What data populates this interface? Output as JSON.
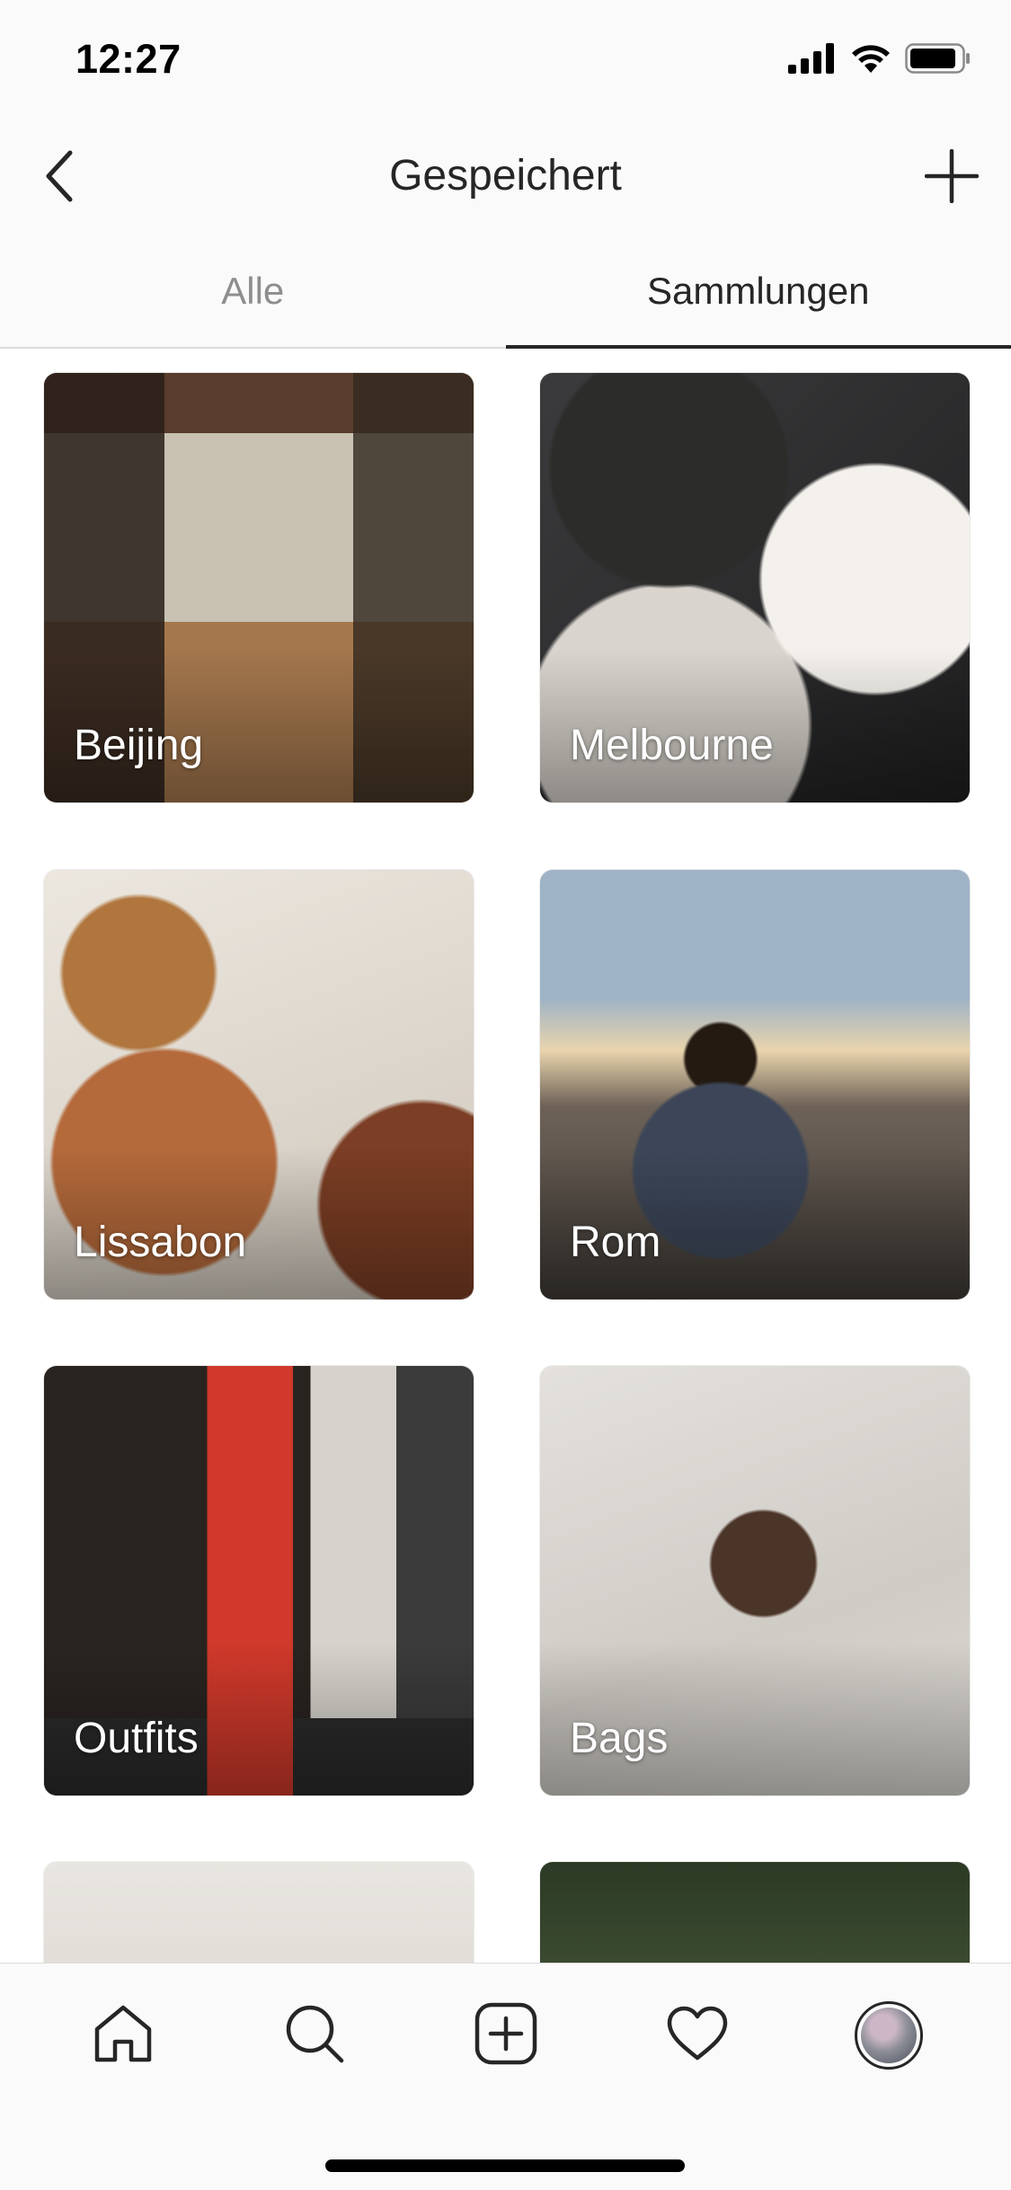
{
  "status_bar": {
    "time": "12:27",
    "icons": [
      "signal-icon",
      "wifi-icon",
      "battery-icon"
    ]
  },
  "header": {
    "title": "Gespeichert",
    "back_icon": "chevron-left-icon",
    "add_icon": "plus-icon"
  },
  "tabs": [
    {
      "label": "Alle",
      "active": false
    },
    {
      "label": "Sammlungen",
      "active": true
    }
  ],
  "collections": [
    {
      "label": "Beijing"
    },
    {
      "label": "Melbourne"
    },
    {
      "label": "Lissabon"
    },
    {
      "label": "Rom"
    },
    {
      "label": "Outfits"
    },
    {
      "label": "Bags"
    },
    {
      "label": ""
    },
    {
      "label": ""
    }
  ],
  "tab_bar": {
    "items": [
      "home-icon",
      "search-icon",
      "new-post-icon",
      "heart-icon",
      "profile-avatar"
    ]
  },
  "colors": {
    "text_primary": "#262626",
    "text_secondary": "#8e8e8e",
    "divider": "#dbdbdb",
    "bar_background": "#fafafa"
  }
}
